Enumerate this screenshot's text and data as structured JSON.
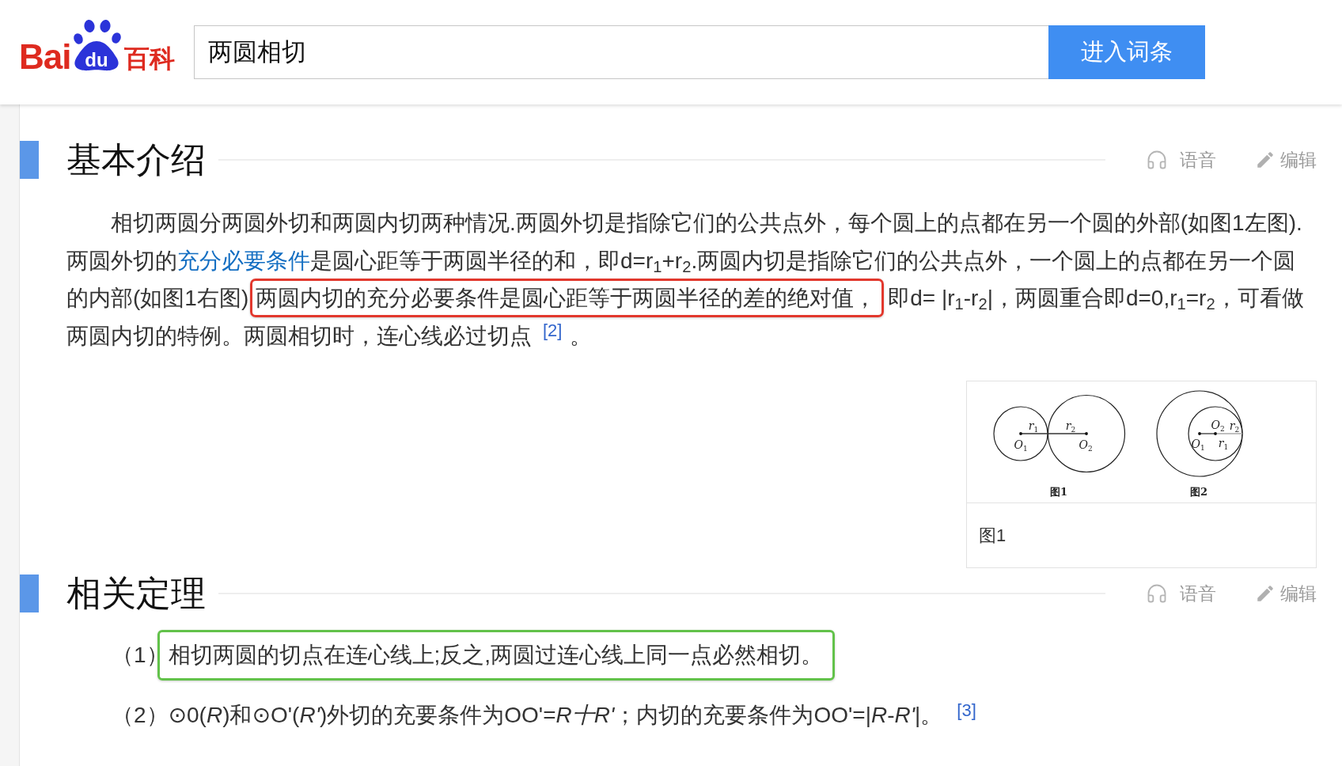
{
  "header": {
    "logo": {
      "part_1": "Bai",
      "part_2": "du",
      "part_3": "百科"
    },
    "search": {
      "value": "两圆相切"
    },
    "submit_button": "进入词条"
  },
  "sections": [
    {
      "title": "基本介绍",
      "actions": [
        {
          "kind": "voice",
          "label": "语音"
        },
        {
          "kind": "edit",
          "label": "编辑"
        }
      ],
      "paragraph": [
        {
          "kind": "text",
          "text": "相切两圆分两圆外切和两圆内切两种情况.两圆外切是指除它们的公共点外，每个圆上的点都在另一个圆的外部(如图1左图).两圆外切的"
        },
        {
          "kind": "link",
          "text": "充分必要条件"
        },
        {
          "kind": "text",
          "text": "是圆心距等于两圆半径的和，即d=r$_{1}$+r$_{2}$.两圆内切是指除它们的公共点外，一个圆上的点都在另一个圆的内部(如图1右图)"
        },
        {
          "kind": "highlight",
          "text": "两圆内切的充分必要条件是圆心距等于两圆半径的差的绝对值，"
        },
        {
          "kind": "text",
          "text": "即d= |r$_{1}$-r$_{2}$|，两圆重合即d=0,r$_{1}$=r$_{2}$，可看做两圆内切的特例。两圆相切时，连心线必过切点"
        },
        {
          "kind": "ref",
          "text": "[2]"
        },
        {
          "kind": "text",
          "text": "。"
        }
      ],
      "figure": {
        "diagrams": [
          {
            "kind": "external",
            "caption": "图1",
            "center_labels": [
              "*O*$_{1}$",
              "*O*$_{2}$"
            ],
            "radius_labels": [
              "*r*$_{1}$",
              "*r*$_{2}$"
            ]
          },
          {
            "kind": "internal",
            "caption": "图2",
            "center_labels": [
              "*O*$_{1}$",
              "*O*$_{2}$"
            ],
            "radius_labels": [
              "*r*$_{1}$",
              "*r*$_{2}$"
            ]
          }
        ],
        "caption": "图1"
      }
    },
    {
      "title": "相关定理",
      "actions": [
        {
          "kind": "voice",
          "label": "语音"
        },
        {
          "kind": "edit",
          "label": "编辑"
        }
      ],
      "items": [
        {
          "number": "（1）",
          "text": "相切两圆的切点在连心线上;反之,两圆过连心线上同一点必然相切。",
          "framed": true
        },
        {
          "number": "（2）",
          "text": "⊙0(*R*)和⊙O'(*R'*)外切的充要条件为OO'=*R十R'*；内切的充要条件为OO'=|*R*-*R'*|。",
          "framed": false,
          "reference": "[3]"
        }
      ]
    }
  ]
}
